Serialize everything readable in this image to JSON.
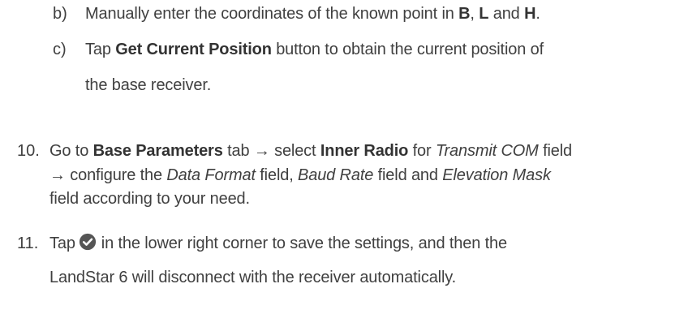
{
  "steps": {
    "b": {
      "marker": "b)",
      "t1": "Manually enter the coordinates of the known point in ",
      "b1": "B",
      "t2": ", ",
      "b2": "L",
      "t3": " and ",
      "b3": "H",
      "t4": "."
    },
    "c": {
      "marker": "c)",
      "t1": "Tap ",
      "b1": "Get Current Position",
      "t2": " button to obtain the current position of",
      "line2": "the base receiver."
    },
    "s10": {
      "marker": "10.",
      "t1": "Go to ",
      "b1": "Base Parameters",
      "t2": " tab → select ",
      "b2": "Inner Radio",
      "t3": " for ",
      "i1": "Transmit COM",
      "t4": " field",
      "l2_t1": "→ configure the ",
      "l2_i1": "Data Format",
      "l2_t2": " field, ",
      "l2_i2": "Baud Rate",
      "l2_t3": " field and ",
      "l2_i3": "Elevation Mask",
      "line3": "field according to your need."
    },
    "s11": {
      "marker": "11.",
      "t1": "Tap",
      "icon": "check-circle-icon",
      "t2": "in the lower right corner to save the settings, and then the",
      "line2": "LandStar 6 will disconnect with the receiver automatically."
    }
  },
  "colors": {
    "text": "#404040",
    "icon": "#555555"
  }
}
